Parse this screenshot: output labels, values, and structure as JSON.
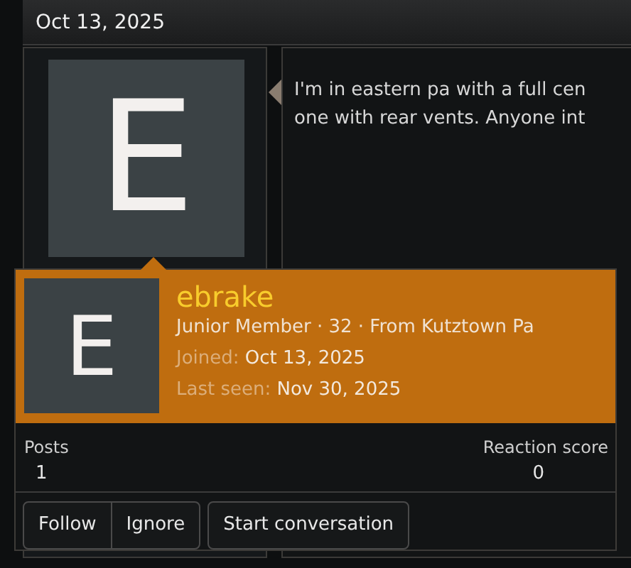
{
  "post": {
    "date": "Oct 13, 2025",
    "avatar_letter": "E",
    "message_lines": [
      "I'm in eastern pa with a full cen",
      "one with rear vents. Anyone int"
    ]
  },
  "member_card": {
    "avatar_letter": "E",
    "username": "ebrake",
    "info": "Junior Member · 32 · From Kutztown Pa",
    "facts": [
      {
        "label": "Joined:",
        "value": "Oct 13, 2025"
      },
      {
        "label": "Last seen:",
        "value": "Nov 30, 2025"
      }
    ],
    "stats": [
      {
        "label": "Posts",
        "value": "1"
      },
      {
        "label": "Reaction score",
        "value": "0"
      }
    ],
    "button_groups": [
      [
        "Follow",
        "Ignore"
      ],
      [
        "Start conversation"
      ]
    ]
  }
}
